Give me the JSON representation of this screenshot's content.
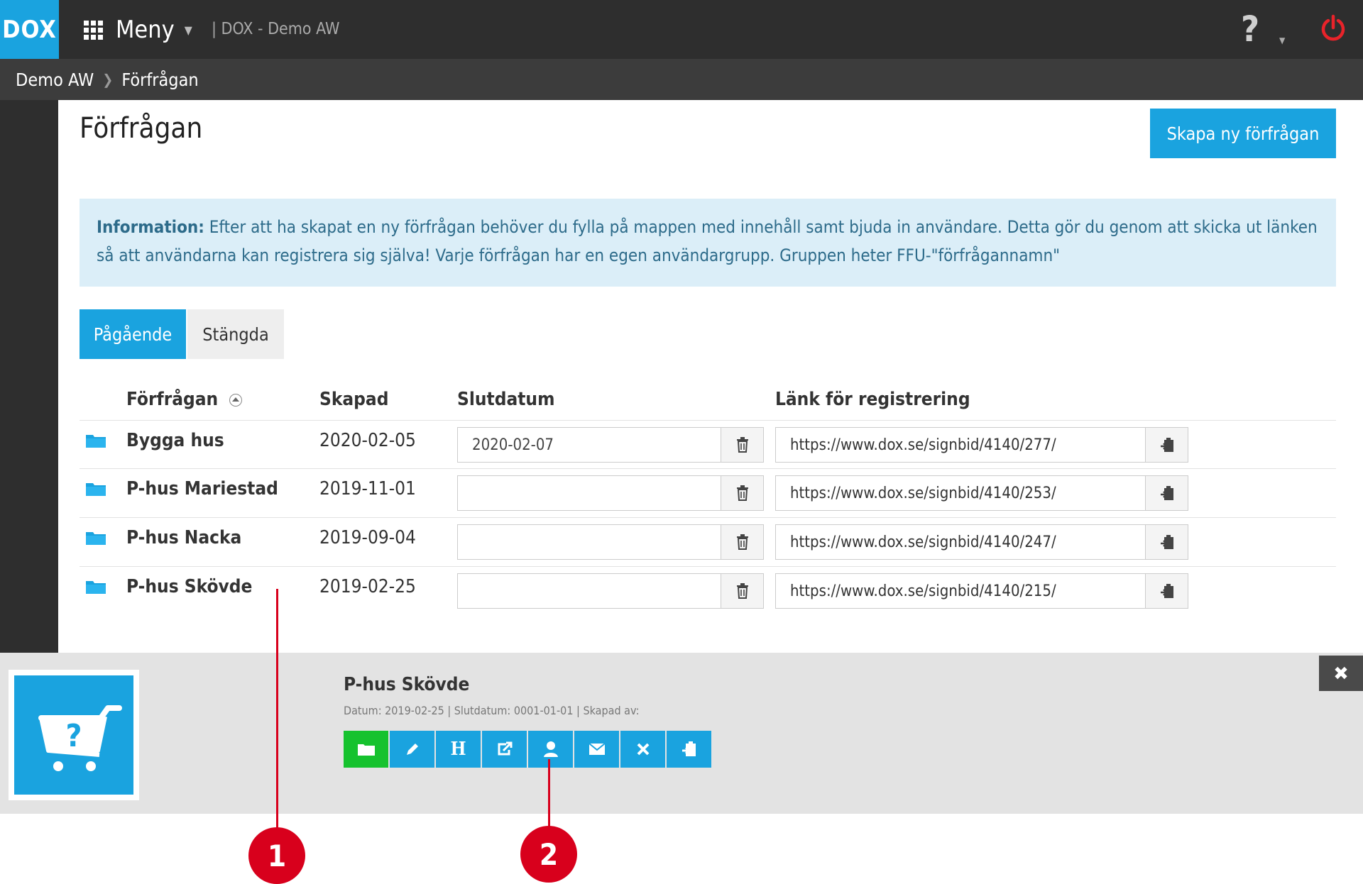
{
  "topbar": {
    "logo": "DOX",
    "menu_label": "Meny",
    "app_title": "| DOX - Demo AW",
    "help_label": "?"
  },
  "breadcrumb": {
    "items": [
      "Demo AW",
      "Förfrågan"
    ],
    "separator": ">"
  },
  "page": {
    "title": "Förfrågan",
    "create_button": "Skapa ny förfrågan"
  },
  "info": {
    "label": "Information:",
    "text": " Efter att ha skapat en ny förfrågan behöver du fylla på mappen med innehåll samt bjuda in användare. Detta gör du genom att skicka ut länken så att användarna kan registrera sig själva! Varje förfrågan har en egen användargrupp. Gruppen heter FFU-\"förfrågannamn\""
  },
  "tabs": [
    {
      "label": "Pågående",
      "active": true
    },
    {
      "label": "Stängda",
      "active": false
    }
  ],
  "table": {
    "headers": {
      "name": "Förfrågan",
      "created": "Skapad",
      "end_date": "Slutdatum",
      "link": "Länk för registrering"
    },
    "rows": [
      {
        "name": "Bygga hus",
        "created": "2020-02-05",
        "end_date": "2020-02-07",
        "link": "https://www.dox.se/signbid/4140/277/"
      },
      {
        "name": "P-hus Mariestad",
        "created": "2019-11-01",
        "end_date": "",
        "link": "https://www.dox.se/signbid/4140/253/"
      },
      {
        "name": "P-hus Nacka",
        "created": "2019-09-04",
        "end_date": "",
        "link": "https://www.dox.se/signbid/4140/247/"
      },
      {
        "name": "P-hus Skövde",
        "created": "2019-02-25",
        "end_date": "",
        "link": "https://www.dox.se/signbid/4140/215/"
      }
    ]
  },
  "detail": {
    "title": "P-hus Skövde",
    "meta": "Datum: 2019-02-25 | Slutdatum: 0001-01-01 | Skapad av:",
    "close_label": "✖",
    "actions": [
      {
        "icon": "folder-icon"
      },
      {
        "icon": "pencil-icon"
      },
      {
        "icon": "h-icon",
        "label": "H"
      },
      {
        "icon": "share-icon"
      },
      {
        "icon": "user-icon"
      },
      {
        "icon": "envelope-icon"
      },
      {
        "icon": "close-icon"
      },
      {
        "icon": "clipboard-icon"
      }
    ]
  },
  "callouts": [
    "1",
    "2"
  ],
  "colors": {
    "accent": "#1aa3df",
    "topbar": "#2e2e2e",
    "breadcrumb": "#3c3c3c",
    "info_bg": "#dbeef8",
    "info_text": "#2d6b8a",
    "panel_bg": "#e3e3e3",
    "green": "#16c22e",
    "callout": "#d8001c",
    "power": "#e8232a"
  }
}
